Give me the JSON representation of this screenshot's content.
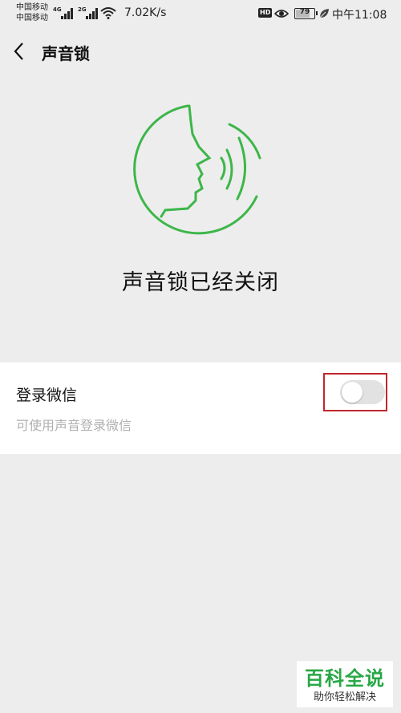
{
  "status_bar": {
    "carrier1": "中国移动",
    "carrier2": "中国移动",
    "sig1_type": "4G",
    "sig2_type": "2G",
    "net_speed": "7.02K/s",
    "hd_badge": "HD",
    "battery_level": "79",
    "time": "中午11:08",
    "icons": [
      "signal-icon",
      "wifi-icon",
      "eye-icon",
      "battery-icon",
      "leaf-icon"
    ]
  },
  "nav": {
    "back_icon": "chevron-left-icon",
    "title": "声音锁"
  },
  "hero": {
    "illustration_icon": "voice-face-icon",
    "status_text": "声音锁已经关闭"
  },
  "setting": {
    "title": "登录微信",
    "description": "可使用声音登录微信",
    "toggle_on": false
  },
  "watermark": {
    "title": "百科全说",
    "subtitle": "助你轻松解决"
  },
  "colors": {
    "accent_green": "#3db649",
    "highlight_red": "#c0272d",
    "background": "#ededed"
  }
}
